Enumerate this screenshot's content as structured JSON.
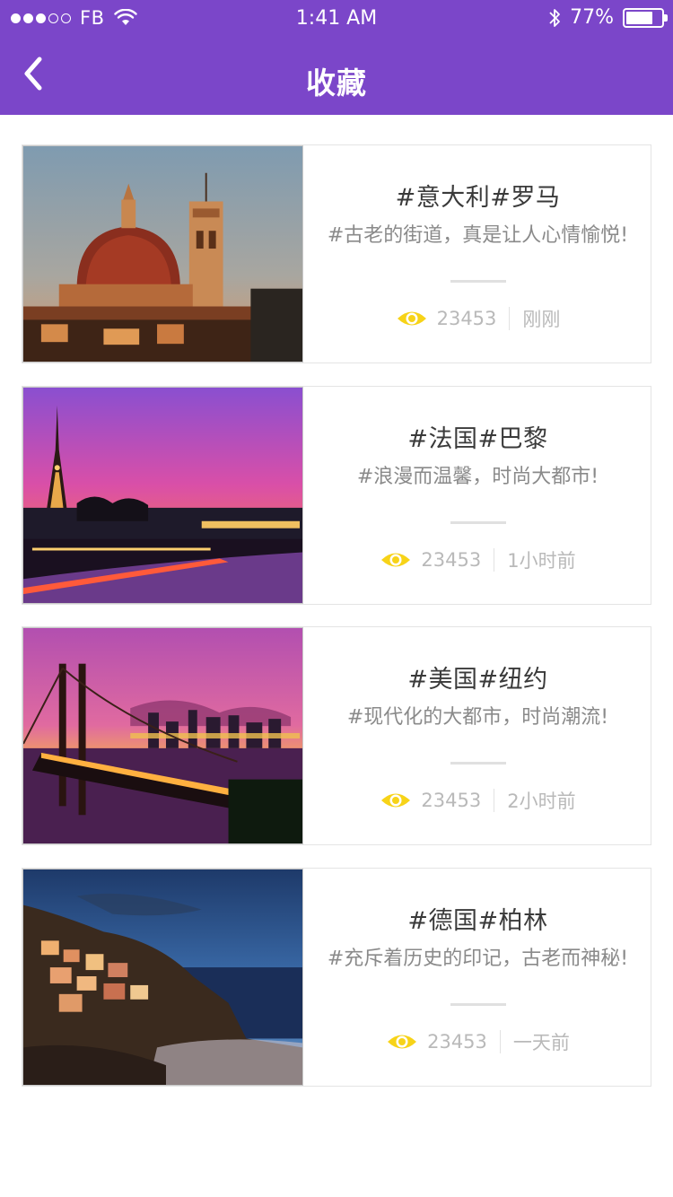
{
  "status_bar": {
    "carrier": "FB",
    "time": "1:41 AM",
    "battery": "77%",
    "battery_level": 0.77,
    "signal_strength": 3
  },
  "nav": {
    "title": "收藏"
  },
  "colors": {
    "header": "#7b46c9",
    "eye_icon": "#f7d318"
  },
  "favorites": [
    {
      "tags": "#意大利#罗马",
      "description": "#古老的街道，真是让人心情愉悦!",
      "views": "23453",
      "time": "刚刚",
      "image": "florence-cathedral-sunset"
    },
    {
      "tags": "#法国#巴黎",
      "description": "#浪漫而温馨，时尚大都市!",
      "views": "23453",
      "time": "1小时前",
      "image": "eiffel-tower-dusk"
    },
    {
      "tags": "#美国#纽约",
      "description": "#现代化的大都市，时尚潮流!",
      "views": "23453",
      "time": "2小时前",
      "image": "bay-bridge-night"
    },
    {
      "tags": "#德国#柏林",
      "description": "#充斥着历史的印记，古老而神秘!",
      "views": "23453",
      "time": "一天前",
      "image": "cliff-village-night"
    }
  ]
}
